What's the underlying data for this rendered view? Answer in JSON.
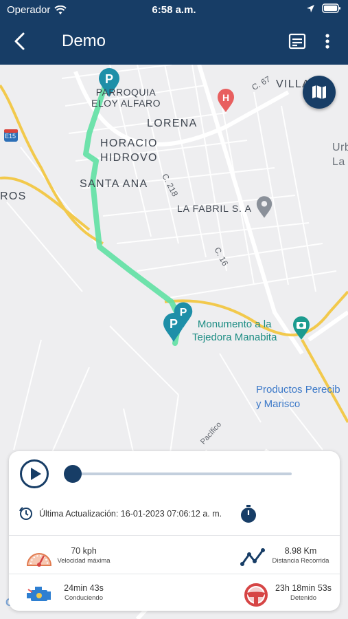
{
  "status_bar": {
    "carrier": "Operador",
    "time": "6:58 a.m."
  },
  "app_bar": {
    "title": "Demo"
  },
  "map": {
    "labels": {
      "parroquia": "PARROQUIA\nELOY ALFARO",
      "villa": "VILLA EL",
      "lorena": "LORENA",
      "horacio": "HORACIO\nHIDROVO",
      "santa_ana": "SANTA ANA",
      "ros": "ROS",
      "urb": "Urb\nLa",
      "fabril": "LA FABRIL S. A",
      "monumento": "Monumento a la\nTejedora Manabita",
      "productos": "Productos Perecib\ny Marisco",
      "c67": "C. 67",
      "c218": "C. 218",
      "c16": "C. 16",
      "e15": "E15",
      "pacifico": "Pacífico"
    },
    "google_mark": "G"
  },
  "panel": {
    "progress": 0.0,
    "last_update_label": "Última Actualización: 16-01-2023 07:06:12 a. m.",
    "stats": {
      "max_speed": {
        "value": "70 kph",
        "label": "Velocidad máxima"
      },
      "distance": {
        "value": "8.98 Km",
        "label": "Distancia Recorrida"
      },
      "driving": {
        "value": "24min 43s",
        "label": "Conduciendo"
      },
      "stopped": {
        "value": "23h 18min 53s",
        "label": "Detenido"
      }
    }
  },
  "colors": {
    "primary": "#173d66",
    "route": "#5fe0a3",
    "highway": "#f2c94c",
    "pin": "#1e8fa8",
    "hospital": "#e85f5f"
  }
}
